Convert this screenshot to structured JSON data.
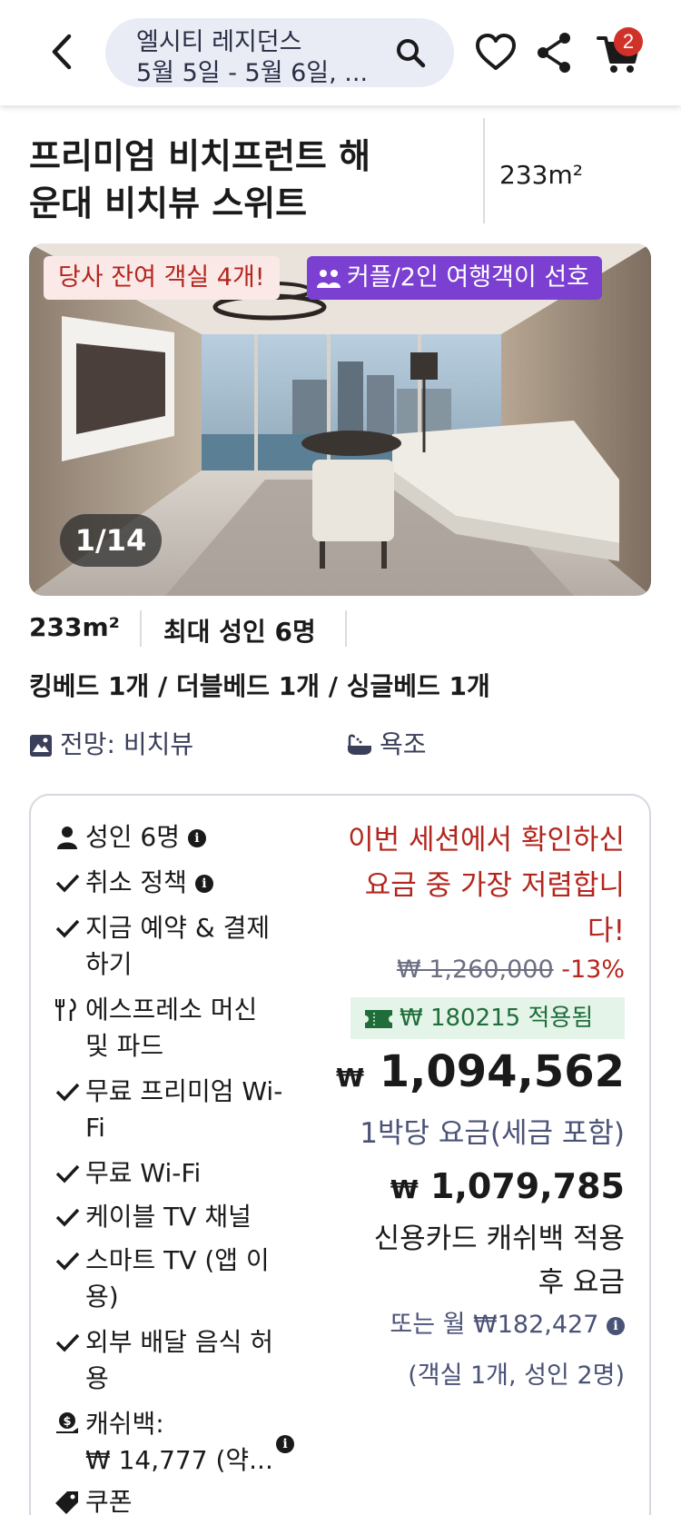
{
  "header": {
    "search_title": "엘시티 레지던스",
    "search_subtitle": "5월 5일 - 5월 6일, ...",
    "cart_count": "2"
  },
  "room": {
    "title_line1": "프리미엄 비치프런트 해",
    "title_line2": "운대 비치뷰 스위트",
    "size": "233m²",
    "photo_counter": "1/14",
    "tag_availability": "당사 잔여 객실 4개!",
    "tag_couple": "커플/2인 여행객이 선호",
    "occupancy": "최대 성인 6명",
    "beds": "킹베드 1개 / 더블베드 1개 / 싱글베드 1개",
    "view": "전망: 비치뷰",
    "bath": "욕조"
  },
  "amenities": {
    "adults": "성인 6명",
    "cancel": "취소 정책",
    "pay_now_1": "지금 예약 & 결제",
    "pay_now_2": "하기",
    "espresso_1": "에스프레소 머신",
    "espresso_2": "및 파드",
    "premium_wifi_1": "무료 프리미엄 Wi-",
    "premium_wifi_2": "Fi",
    "free_wifi": "무료 Wi-Fi",
    "cable_tv": "케이블 TV 채널",
    "smart_tv_1": "스마트 TV (앱 이",
    "smart_tv_2": "용)",
    "delivery_1": "외부 배달 음식 허",
    "delivery_2": "용",
    "cashback_1": "캐쉬백:",
    "cashback_2": "₩ 14,777 (약...",
    "coupon": "쿠폰"
  },
  "pricing": {
    "cheapest_1": "이번 세션에서 확인하신",
    "cheapest_2": "요금 중 가장 저렴합니",
    "cheapest_3": "다!",
    "original_price": "₩ 1,260,000",
    "discount": "-13%",
    "coupon_applied": "₩ 180215 적용됨",
    "currency": "₩",
    "price": "1,094,562",
    "per_night": "1박당 요금(세금 포함)",
    "cashback_price": "1,079,785",
    "cashback_label_1": "신용카드 캐쉬백 적용",
    "cashback_label_2": "후 요금",
    "monthly": "또는 월 ₩182,427",
    "room_count": "(객실 1개, 성인 2명)"
  },
  "colors": {
    "accent_red": "#b3261e",
    "couple_purple": "#7b3fd1",
    "coupon_green": "#1f6e3a",
    "muted_blue": "#4a5276"
  }
}
